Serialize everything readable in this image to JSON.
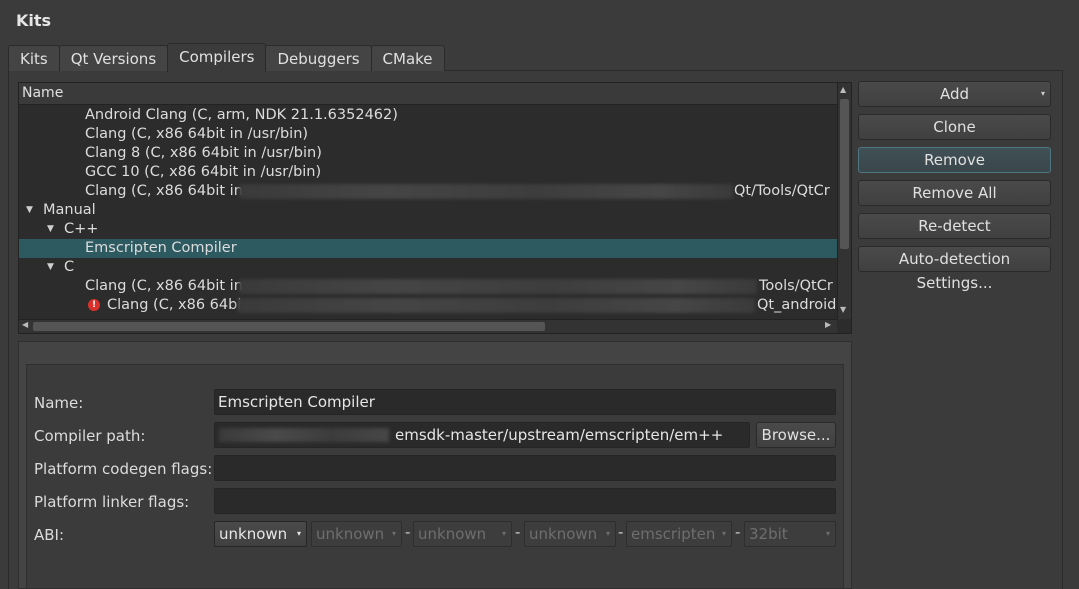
{
  "page_title": "Kits",
  "tabs": [
    "Kits",
    "Qt Versions",
    "Compilers",
    "Debuggers",
    "CMake"
  ],
  "tree": {
    "header": "Name",
    "rows": [
      {
        "text": "Android Clang (C, arm, NDK 21.1.6352462)"
      },
      {
        "text": "Clang (C, x86 64bit in /usr/bin)"
      },
      {
        "text": "Clang 8 (C, x86 64bit in /usr/bin)"
      },
      {
        "text": "GCC 10 (C, x86 64bit in /usr/bin)"
      },
      {
        "text": "Clang (C, x86 64bit in",
        "suffix": "Qt/Tools/QtCr"
      },
      {
        "text": "Manual"
      },
      {
        "text": "C++"
      },
      {
        "text": "Emscripten Compiler"
      },
      {
        "text": "C"
      },
      {
        "text": "Clang (C, x86 64bit in",
        "suffix": "Tools/QtCr"
      },
      {
        "text": "Clang (C, x86 64bi",
        "suffix": "Qt_android"
      }
    ]
  },
  "buttons": {
    "add": "Add",
    "clone": "Clone",
    "remove": "Remove",
    "remove_all": "Remove All",
    "redetect": "Re-detect",
    "autodetect": "Auto-detection Settings..."
  },
  "details": {
    "name_label": "Name:",
    "name_value": "Emscripten Compiler",
    "path_label": "Compiler path:",
    "path_value": "emsdk-master/upstream/emscripten/em++",
    "browse": "Browse...",
    "codegen_label": "Platform codegen flags:",
    "codegen_value": "",
    "linker_label": "Platform linker flags:",
    "linker_value": "",
    "abi_label": "ABI:",
    "abi": [
      "unknown",
      "unknown",
      "unknown",
      "unknown",
      "emscripten",
      "32bit"
    ]
  },
  "colors": {
    "selection": "#2d5a61",
    "error": "#d9302b"
  }
}
